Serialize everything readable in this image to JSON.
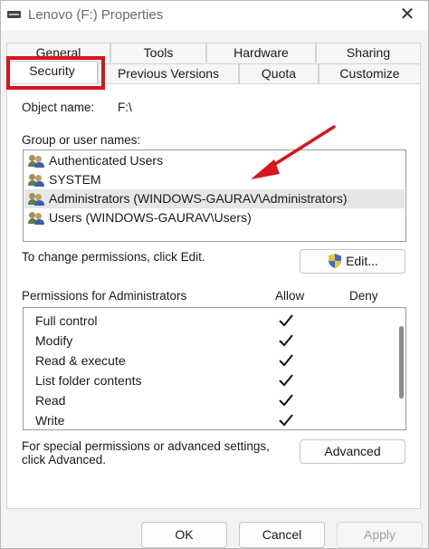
{
  "window": {
    "title": "Lenovo (F:) Properties",
    "close_glyph": "✕"
  },
  "tabs": {
    "back_row": [
      "General",
      "Tools",
      "Hardware",
      "Sharing"
    ],
    "front_row": [
      "Security",
      "Previous Versions",
      "Quota",
      "Customize"
    ],
    "active": "Security"
  },
  "security": {
    "object_name_label": "Object name:",
    "object_name_value": "F:\\",
    "group_label": "Group or user names:",
    "groups": [
      "Authenticated Users",
      "SYSTEM",
      "Administrators (WINDOWS-GAURAV\\Administrators)",
      "Users (WINDOWS-GAURAV\\Users)"
    ],
    "selected_group_index": 2,
    "change_text": "To change permissions, click Edit.",
    "edit_label": "Edit...",
    "permissions_for": "Permissions for Administrators",
    "allow_header": "Allow",
    "deny_header": "Deny",
    "permissions": [
      {
        "name": "Full control",
        "allow": true,
        "deny": false
      },
      {
        "name": "Modify",
        "allow": true,
        "deny": false
      },
      {
        "name": "Read & execute",
        "allow": true,
        "deny": false
      },
      {
        "name": "List folder contents",
        "allow": true,
        "deny": false
      },
      {
        "name": "Read",
        "allow": true,
        "deny": false
      },
      {
        "name": "Write",
        "allow": true,
        "deny": false
      }
    ],
    "special_text_line1": "For special permissions or advanced settings,",
    "special_text_line2": "click Advanced.",
    "advanced_label": "Advanced"
  },
  "footer": {
    "ok_label": "OK",
    "cancel_label": "Cancel",
    "apply_label": "Apply"
  },
  "annotations": {
    "highlight_color": "#d8141c",
    "arrow_color": "#d8141c"
  },
  "icons": [
    "drive-icon",
    "close-icon",
    "users-icon",
    "uac-shield-icon",
    "check-icon"
  ]
}
